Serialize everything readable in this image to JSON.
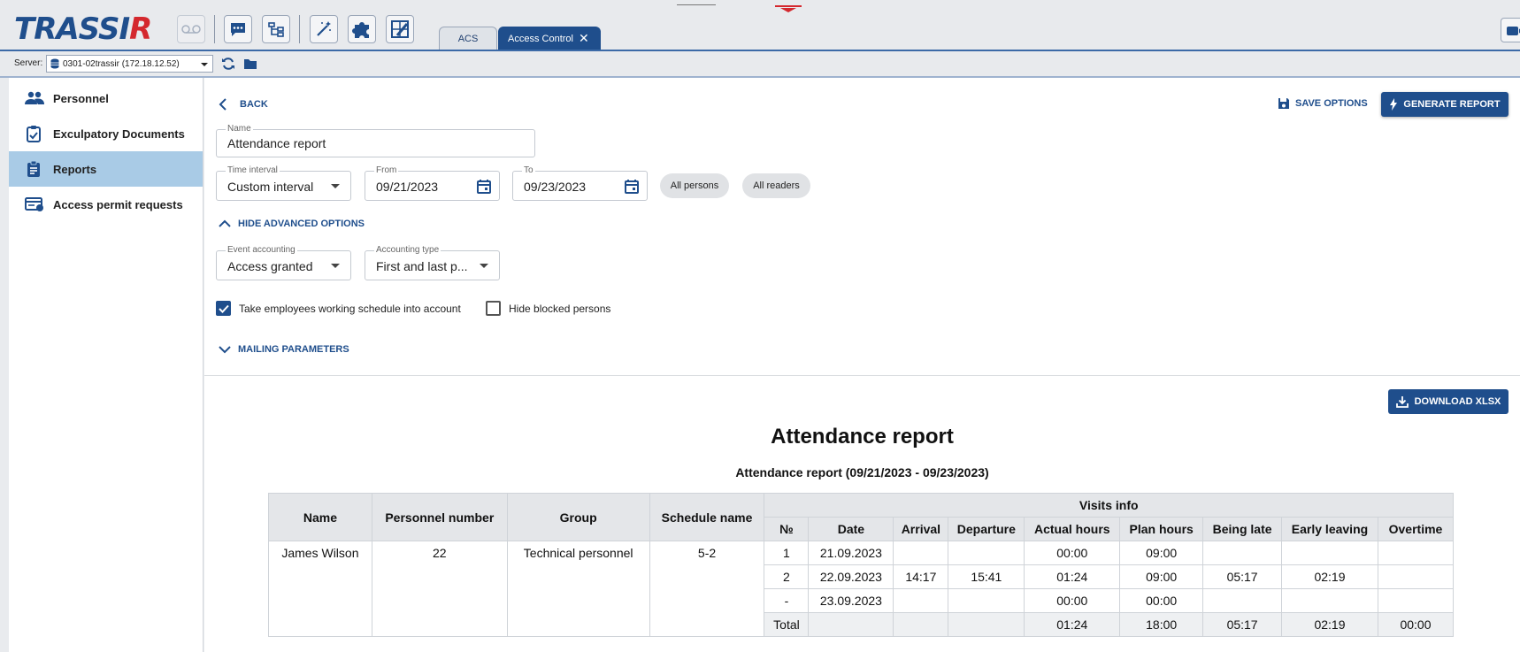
{
  "app": {
    "logo": "TRASSIR"
  },
  "toolbar": {
    "icons": [
      "voicemail-icon",
      "chat-icon",
      "hierarchy-icon",
      "wand-icon",
      "puzzle-icon",
      "layout-edit-icon"
    ]
  },
  "tabs": [
    {
      "label": "ACS"
    },
    {
      "label": "Access Control",
      "close": "✕"
    }
  ],
  "server": {
    "label": "Server:",
    "value": "0301-02trassir (172.18.12.52)"
  },
  "sidebar": {
    "items": [
      {
        "label": "Personnel",
        "icon": "people-icon"
      },
      {
        "label": "Exculpatory Documents",
        "icon": "clipboard-check-icon"
      },
      {
        "label": "Reports",
        "icon": "clipboard-list-icon",
        "selected": true
      },
      {
        "label": "Access permit requests",
        "icon": "id-card-icon"
      }
    ]
  },
  "header": {
    "back": "BACK",
    "save_options": "SAVE OPTIONS",
    "generate_report": "GENERATE REPORT"
  },
  "form": {
    "name": {
      "label": "Name",
      "value": "Attendance report"
    },
    "time_interval": {
      "label": "Time interval",
      "value": "Custom interval"
    },
    "from": {
      "label": "From",
      "value": "09/21/2023"
    },
    "to": {
      "label": "To",
      "value": "09/23/2023"
    },
    "all_persons": "All persons",
    "all_readers": "All readers",
    "hide_advanced": "HIDE ADVANCED OPTIONS",
    "event_accounting": {
      "label": "Event accounting",
      "value": "Access granted"
    },
    "accounting_type": {
      "label": "Accounting type",
      "value": "First and last p..."
    },
    "schedule_checkbox": {
      "label": "Take employees working schedule into account",
      "checked": true
    },
    "blocked_checkbox": {
      "label": "Hide blocked persons",
      "checked": false
    },
    "mailing": "MAILING PARAMETERS"
  },
  "report": {
    "download": "DOWNLOAD XLSX",
    "title": "Attendance report",
    "subtitle": "Attendance report (09/21/2023 - 09/23/2023)",
    "headers": {
      "name": "Name",
      "personnel_number": "Personnel number",
      "group": "Group",
      "schedule_name": "Schedule name",
      "visits_info": "Visits info",
      "no": "№",
      "date": "Date",
      "arrival": "Arrival",
      "departure": "Departure",
      "actual_hours": "Actual hours",
      "plan_hours": "Plan hours",
      "being_late": "Being late",
      "early_leaving": "Early leaving",
      "overtime": "Overtime"
    },
    "person": {
      "name": "James Wilson",
      "personnel_number": "22",
      "group": "Technical personnel",
      "schedule_name": "5-2"
    },
    "rows": [
      {
        "no": "1",
        "date": "21.09.2023",
        "arrival": "",
        "departure": "",
        "actual": "00:00",
        "plan": "09:00",
        "late": "",
        "early": "",
        "overtime": ""
      },
      {
        "no": "2",
        "date": "22.09.2023",
        "arrival": "14:17",
        "departure": "15:41",
        "actual": "01:24",
        "plan": "09:00",
        "late": "05:17",
        "early": "02:19",
        "overtime": ""
      },
      {
        "no": "-",
        "date": "23.09.2023",
        "arrival": "",
        "departure": "",
        "actual": "00:00",
        "plan": "00:00",
        "late": "",
        "early": "",
        "overtime": ""
      }
    ],
    "total": {
      "label": "Total",
      "actual": "01:24",
      "plan": "18:00",
      "late": "05:17",
      "early": "02:19",
      "overtime": "00:00"
    }
  }
}
